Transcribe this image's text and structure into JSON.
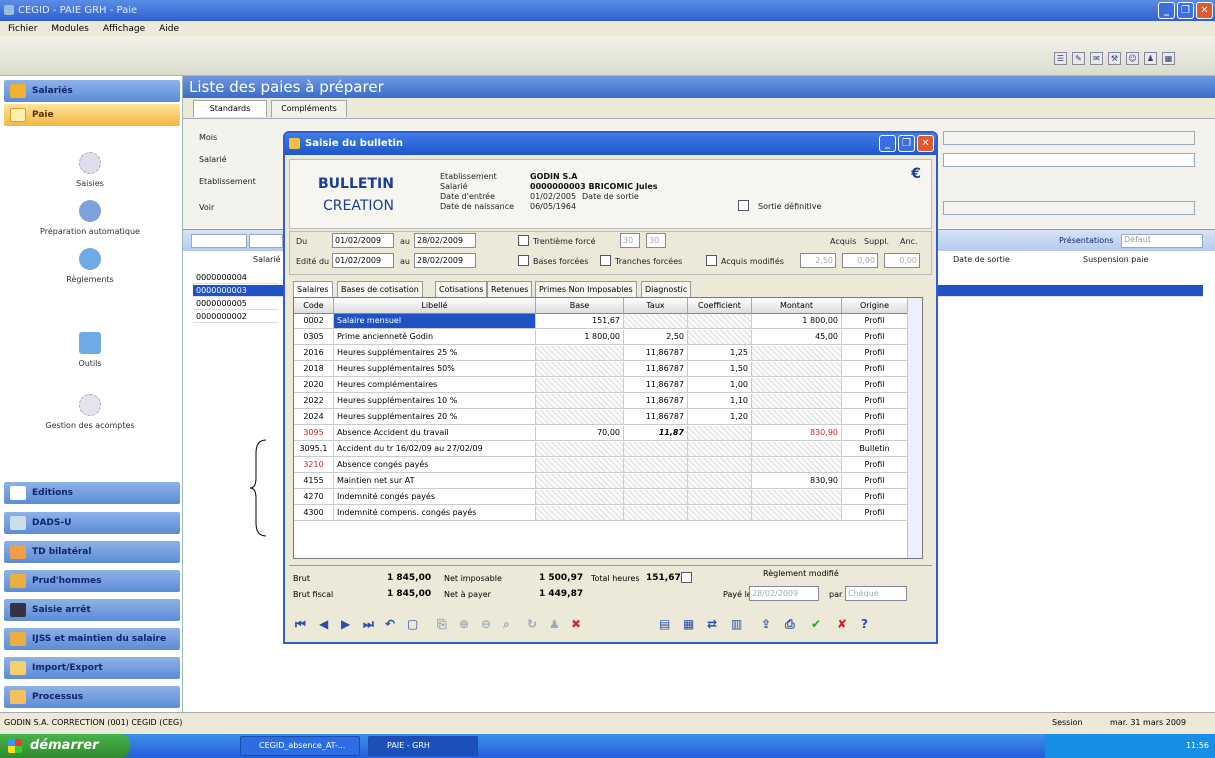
{
  "window": {
    "title": "CEGID - PAIE GRH - Paie"
  },
  "menu": [
    "Fichier",
    "Modules",
    "Affichage",
    "Aide"
  ],
  "sidebar": {
    "top_header": "Salariés",
    "selected_header": "Paie",
    "items": [
      {
        "label": "Saisies"
      },
      {
        "label": "Préparation automatique"
      },
      {
        "label": "Règlements"
      },
      {
        "label": "Outils"
      },
      {
        "label": "Gestion des acomptes"
      }
    ],
    "bottom_headers": [
      "Editions",
      "DADS-U",
      "TD bilatéral",
      "Prud'hommes",
      "Saisie arrêt",
      "IJSS et maintien du salaire",
      "Import/Export",
      "Processus"
    ]
  },
  "main": {
    "title": "Liste des paies à préparer",
    "tabs": [
      "Standards",
      "Compléments"
    ],
    "filter_labels": [
      "Mois",
      "Salarié",
      "Etablissement",
      "Voir"
    ],
    "presentations_label": "Présentations",
    "presentations_value": "Défaut",
    "grid_columns": [
      "Salarié",
      "Date de sortie",
      "Suspension paie"
    ],
    "grid_rows": [
      "0000000004",
      "0000000003",
      "0000000005",
      "0000000002"
    ]
  },
  "dialog": {
    "title": "Saisie du bulletin",
    "big1": "BULLETIN",
    "big2": "CREATION",
    "currency_icon": "€",
    "labels": {
      "etab": "Etablissement",
      "salarie": "Salarié",
      "entree": "Date d'entrée",
      "naissance": "Date de naissance",
      "sortie": "Date de sortie",
      "sortie_def": "Sortie définitive"
    },
    "values": {
      "etab": "GODIN S.A",
      "salarie": "0000000003  BRICOMIC Jules",
      "entree": "01/02/2005",
      "naissance": "06/05/1964"
    },
    "period": {
      "du_label": "Du",
      "du": "01/02/2009",
      "au_label": "au",
      "au": "28/02/2009",
      "edite_label": "Edité du",
      "edite_du": "01/02/2009",
      "edite_au": "28/02/2009",
      "trentieme": "Trentième forcé",
      "trentieme_v1": "30",
      "trentieme_v2": "30",
      "bases": "Bases forcées",
      "tranches": "Tranches forcées",
      "acquis_mod": "Acquis modifiés",
      "acquis": "Acquis",
      "suppl": "Suppl.",
      "anc": "Anc.",
      "acquis_v": "2,50",
      "suppl_v": "0,00",
      "anc_v": "0,00"
    },
    "subtabs": [
      "Salaires",
      "Bases de cotisation",
      "Cotisations",
      "Retenues",
      "Primes Non Imposables",
      "Diagnostic"
    ],
    "columns": [
      "Code",
      "Libellé",
      "Base",
      "Taux",
      "Coefficient",
      "Montant",
      "Origine"
    ],
    "rows": [
      {
        "code": "0002",
        "lib": "Salaire mensuel",
        "base": "151,67",
        "taux": "",
        "coef": "",
        "montant": "1 800,00",
        "orig": "Profil"
      },
      {
        "code": "0305",
        "lib": "Prime ancienneté Godin",
        "base": "1 800,00",
        "taux": "2,50",
        "coef": "",
        "montant": "45,00",
        "orig": "Profil"
      },
      {
        "code": "2016",
        "lib": "Heures supplémentaires 25 %",
        "base": "",
        "taux": "11,86787",
        "coef": "1,25",
        "montant": "",
        "orig": "Profil"
      },
      {
        "code": "2018",
        "lib": "Heures supplémentaires 50%",
        "base": "",
        "taux": "11,86787",
        "coef": "1,50",
        "montant": "",
        "orig": "Profil"
      },
      {
        "code": "2020",
        "lib": "Heures complémentaires",
        "base": "",
        "taux": "11,86787",
        "coef": "1,00",
        "montant": "",
        "orig": "Profil"
      },
      {
        "code": "2022",
        "lib": "Heures supplémentaires 10 %",
        "base": "",
        "taux": "11,86787",
        "coef": "1,10",
        "montant": "",
        "orig": "Profil"
      },
      {
        "code": "2024",
        "lib": "Heures supplémentaires 20 %",
        "base": "",
        "taux": "11,86787",
        "coef": "1,20",
        "montant": "",
        "orig": "Profil"
      },
      {
        "code": "3095",
        "lib": "Absence Accident du travail",
        "base": "70,00",
        "taux": "11,87",
        "coef": "",
        "montant": "830,90",
        "orig": "Profil"
      },
      {
        "code": "3095.1",
        "lib": "Accident du tr 16/02/09 au 27/02/09",
        "base": "",
        "taux": "",
        "coef": "",
        "montant": "",
        "orig": "Bulletin"
      },
      {
        "code": "3210",
        "lib": "Absence congés payés",
        "base": "",
        "taux": "",
        "coef": "",
        "montant": "",
        "orig": "Profil"
      },
      {
        "code": "4155",
        "lib": "Maintien net sur AT",
        "base": "",
        "taux": "",
        "coef": "",
        "montant": "830,90",
        "orig": "Profil"
      },
      {
        "code": "4270",
        "lib": "Indemnité congés payés",
        "base": "",
        "taux": "",
        "coef": "",
        "montant": "",
        "orig": "Profil"
      },
      {
        "code": "4300",
        "lib": "Indemnité compens. congés payés",
        "base": "",
        "taux": "",
        "coef": "",
        "montant": "",
        "orig": "Profil"
      }
    ],
    "totals": {
      "brut_l": "Brut",
      "brut": "1 845,00",
      "brutfisc_l": "Brut fiscal",
      "brutfisc": "1 845,00",
      "netimp_l": "Net imposable",
      "netimp": "1 500,97",
      "netpay_l": "Net à payer",
      "netpay": "1 449,87",
      "heures_l": "Total heures",
      "heures": "151,67",
      "reglement": "Règlement modifié",
      "paye_le": "Payé le",
      "paye_date": "28/02/2009",
      "par": "par",
      "mode": "Chèque"
    }
  },
  "status": {
    "left": "GODIN S.A. CORRECTION (001)   CEGID (CEG)",
    "session": "Session",
    "date": "mar. 31 mars 2009"
  },
  "taskbar": {
    "start": "démarrer",
    "tasks": [
      "CEGID_absence_AT-...",
      "PAIE - GRH"
    ],
    "clock": "11:56"
  },
  "colors": {
    "accent": "#2f5fcf",
    "selection": "#1f52c2",
    "warning_red": "#d22222"
  }
}
